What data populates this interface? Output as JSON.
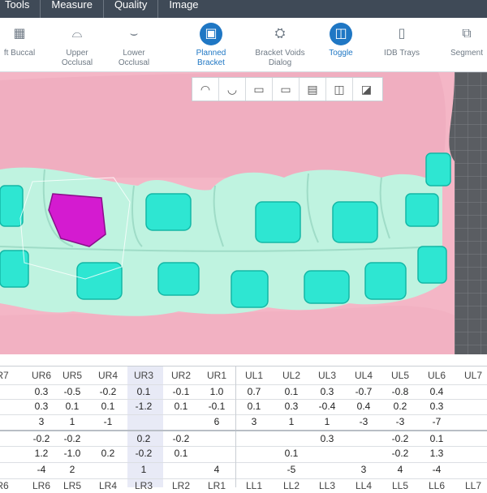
{
  "menu": [
    "Tools",
    "Measure",
    "Quality",
    "Image"
  ],
  "toolbar": [
    {
      "label": "ft Buccal",
      "icon": "buccal-teeth-icon",
      "active": false
    },
    {
      "label": "Upper\nOcclusal",
      "icon": "upper-arch-icon",
      "active": false
    },
    {
      "label": "Lower\nOcclusal",
      "icon": "lower-arch-icon",
      "active": false
    },
    {
      "label": "Planned\nBracket",
      "icon": "planned-bracket-icon",
      "active": true
    },
    {
      "label": "Bracket Voids\nDialog",
      "icon": "bracket-voids-icon",
      "active": false
    },
    {
      "label": "Toggle",
      "icon": "toggle-icon",
      "active": true
    },
    {
      "label": "IDB Trays",
      "icon": "idb-trays-icon",
      "active": false
    },
    {
      "label": "Segment",
      "icon": "segment-icon",
      "active": false
    }
  ],
  "view_buttons": [
    "upper-occlusal-view-icon",
    "lower-occlusal-view-icon",
    "buccal-view-icon",
    "frontal-view-icon",
    "lingual-view-icon",
    "hide-brackets-icon",
    "show-brackets-icon"
  ],
  "colors": {
    "accent": "#1f77c4",
    "bracket": "#2ee6d2",
    "selected_bracket": "#d41bd0",
    "gingiva": "#f4b6c6",
    "teeth": "#bff3e0"
  },
  "table": {
    "upper_headers": [
      "R7",
      "UR6",
      "UR5",
      "UR4",
      "UR3",
      "UR2",
      "UR1",
      "UL1",
      "UL2",
      "UL3",
      "UL4",
      "UL5",
      "UL6",
      "UL7"
    ],
    "lower_headers": [
      "R6",
      "LR6",
      "LR5",
      "LR4",
      "LR3",
      "LR2",
      "LR1",
      "LL1",
      "LL2",
      "LL3",
      "LL4",
      "LL5",
      "LL6",
      "LL7"
    ],
    "rows": [
      [
        "",
        "0.3",
        "-0.5",
        "-0.2",
        "0.1",
        "-0.1",
        "1.0",
        "0.7",
        "0.1",
        "0.3",
        "-0.7",
        "-0.8",
        "0.4",
        ""
      ],
      [
        "",
        "0.3",
        "0.1",
        "0.1",
        "-1.2",
        "0.1",
        "-0.1",
        "0.1",
        "0.3",
        "-0.4",
        "0.4",
        "0.2",
        "0.3",
        ""
      ],
      [
        "",
        "3",
        "1",
        "-1",
        "",
        "",
        "6",
        "3",
        "1",
        "1",
        "-3",
        "-3",
        "-7",
        ""
      ],
      [
        "",
        "-0.2",
        "-0.2",
        "",
        "0.2",
        "-0.2",
        "",
        "",
        "",
        "0.3",
        "",
        "-0.2",
        "0.1",
        ""
      ],
      [
        "",
        "1.2",
        "-1.0",
        "0.2",
        "-0.2",
        "0.1",
        "",
        "",
        "0.1",
        "",
        "",
        "-0.2",
        "1.3",
        ""
      ],
      [
        "",
        "-4",
        "2",
        "",
        "1",
        "",
        "4",
        "",
        "-5",
        "",
        "3",
        "4",
        "-4",
        ""
      ]
    ]
  }
}
